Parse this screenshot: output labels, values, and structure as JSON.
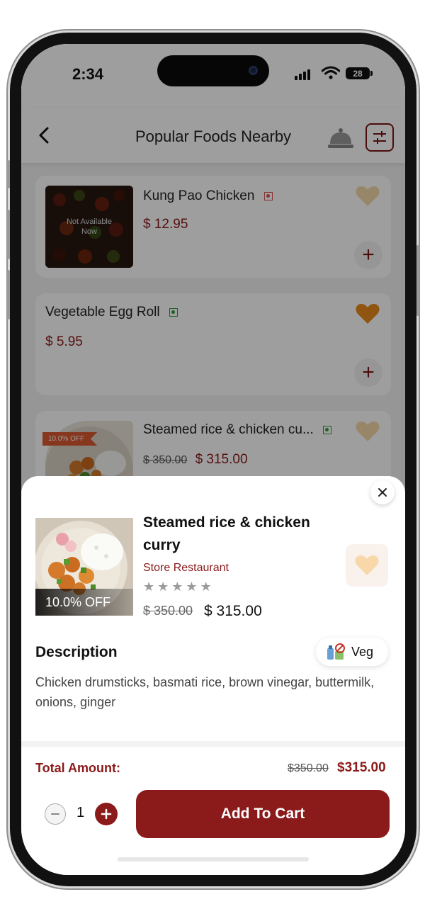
{
  "status_bar": {
    "time": "2:34",
    "battery": "28"
  },
  "header": {
    "title": "Popular Foods Nearby"
  },
  "food_list": [
    {
      "name": "Kung Pao Chicken",
      "diet": "non-veg",
      "price": "$ 12.95",
      "overlay_text": "Not Available Now",
      "favorite": false
    },
    {
      "name": "Vegetable Egg Roll",
      "diet": "veg",
      "price": "$ 5.95",
      "favorite": true
    },
    {
      "name": "Steamed rice & chicken cu...",
      "diet": "veg",
      "old_price": "$ 350.00",
      "price": "$ 315.00",
      "discount": "10.0% OFF",
      "favorite": false
    }
  ],
  "detail": {
    "name": "Steamed rice & chicken curry",
    "store": "Store Restaurant",
    "rating_stars": 0,
    "discount": "10.0% OFF",
    "old_price": "$ 350.00",
    "new_price": "$ 315.00",
    "description_title": "Description",
    "description": "Chicken drumsticks, basmati rice, brown vinegar, buttermilk, onions, ginger",
    "diet_label": "Veg",
    "total_label": "Total Amount:",
    "total_old": "$350.00",
    "total_new": "$315.00",
    "quantity": "1",
    "add_to_cart_label": "Add To Cart"
  },
  "colors": {
    "brand": "#8b1a1a",
    "veg": "#2e9e3a",
    "non_veg": "#d9534f",
    "favorite_active": "#e8891a",
    "favorite_inactive": "#f5d9a8"
  }
}
